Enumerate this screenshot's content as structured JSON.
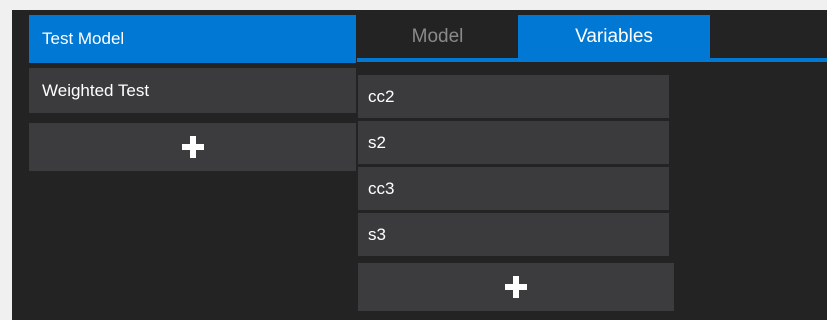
{
  "models": [
    {
      "label": "Test Model",
      "selected": true
    },
    {
      "label": "Weighted Test",
      "selected": false
    }
  ],
  "add_model_icon": "plus-icon",
  "tabs": [
    {
      "label": "Model",
      "active": false
    },
    {
      "label": "Variables",
      "active": true
    }
  ],
  "variables": [
    {
      "label": "cc2"
    },
    {
      "label": "s2"
    },
    {
      "label": "cc3"
    },
    {
      "label": "s3"
    }
  ],
  "add_variable_icon": "plus-icon",
  "colors": {
    "accent": "#0078d4",
    "background": "#232323",
    "item": "#3b3b3e",
    "inactive_tab_text": "#8a8a8a"
  }
}
